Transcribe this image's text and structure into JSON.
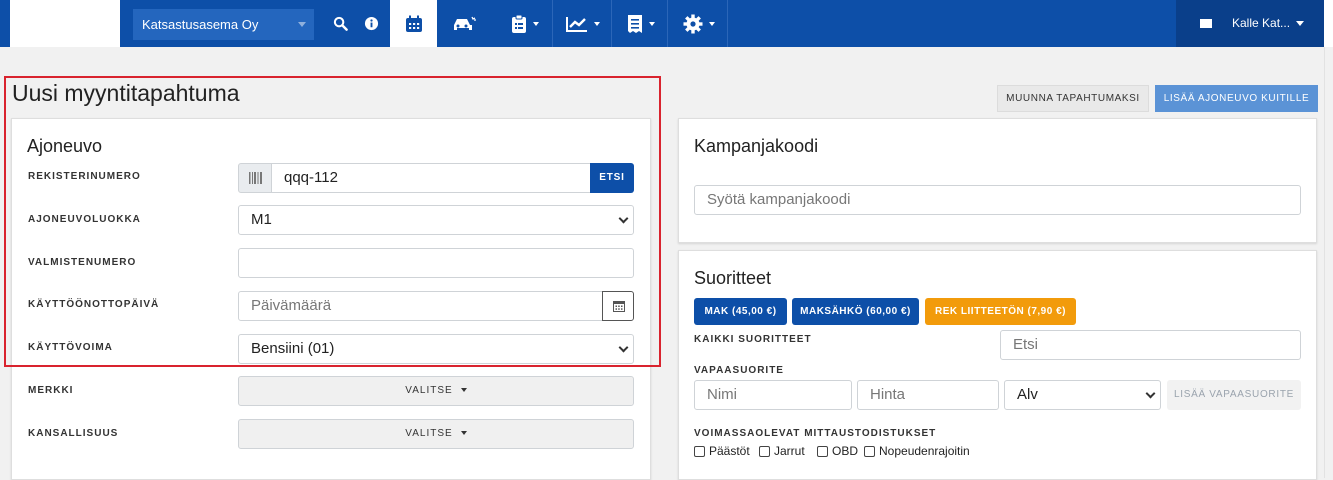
{
  "nav": {
    "company": "Katsastusasema Oy",
    "user": "Kalle Kat...",
    "icons": [
      "search-icon",
      "info-icon",
      "calendar-icon",
      "car-icon",
      "clipboard-icon",
      "chart-icon",
      "receipt-icon",
      "gear-icon",
      "mail-icon"
    ]
  },
  "page": {
    "title": "Uusi myyntitapahtuma",
    "convert_button": "MUUNNA TAPAHTUMAKSI",
    "add_vehicle_button": "LISÄÄ AJONEUVO KUITILLE"
  },
  "vehicle": {
    "section_title": "Ajoneuvo",
    "reg_label": "REKISTERINUMERO",
    "reg_value": "qqq-112",
    "search_button": "ETSI",
    "class_label": "AJONEUVOLUOKKA",
    "class_value": "M1",
    "vin_label": "VALMISTENUMERO",
    "vin_value": "",
    "date_label": "KÄYTTÖÖNOTTOPÄIVÄ",
    "date_placeholder": "Päivämäärä",
    "fuel_label": "KÄYTTÖVOIMA",
    "fuel_value": "Bensiini (01)",
    "brand_label": "MERKKI",
    "brand_button": "VALITSE",
    "nationality_label": "KANSALLISUUS",
    "nationality_button": "VALITSE"
  },
  "campaign": {
    "section_title": "Kampanjakoodi",
    "placeholder": "Syötä kampanjakoodi"
  },
  "services": {
    "section_title": "Suoritteet",
    "quick": [
      {
        "label": "MAK (45,00 €)",
        "color": "#0d4fa8"
      },
      {
        "label": "MAKSÄHKÖ (60,00 €)",
        "color": "#0d4fa8"
      },
      {
        "label": "REK LIITTEETÖN (7,90 €)",
        "color": "#f29b0b"
      }
    ],
    "all_label": "KAIKKI SUORITTEET",
    "search_placeholder": "Etsi",
    "free_label": "VAPAASUORITE",
    "name_placeholder": "Nimi",
    "price_placeholder": "Hinta",
    "vat_value": "Alv",
    "add_free_button": "LISÄÄ VAPAASUORITE",
    "certs_label": "VOIMASSAOLEVAT MITTAUSTODISTUKSET",
    "certs": [
      "Päästöt",
      "Jarrut",
      "OBD",
      "Nopeudenrajoitin"
    ]
  }
}
